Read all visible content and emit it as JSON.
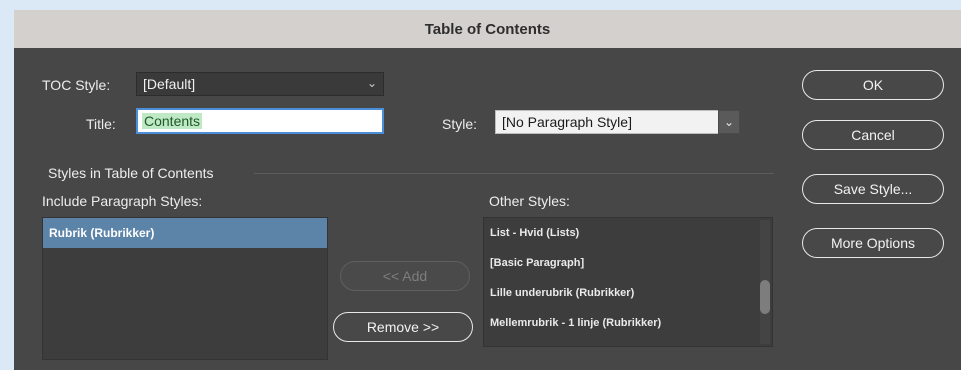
{
  "dialog": {
    "title": "Table of Contents"
  },
  "toc_style": {
    "label": "TOC Style:",
    "value": "[Default]"
  },
  "title_field": {
    "label": "Title:",
    "value": "Contents"
  },
  "style_field": {
    "label": "Style:",
    "value": "[No Paragraph Style]"
  },
  "section_heading": "Styles in Table of Contents",
  "include_styles": {
    "label": "Include Paragraph Styles:",
    "items": [
      "Rubrik (Rubrikker)"
    ]
  },
  "other_styles": {
    "label": "Other Styles:",
    "items": [
      "List - Hvid (Lists)",
      "[Basic Paragraph]",
      "Lille underubrik (Rubrikker)",
      "Mellemrubrik - 1 linje (Rubrikker)"
    ]
  },
  "buttons": {
    "ok": "OK",
    "cancel": "Cancel",
    "save_style": "Save Style...",
    "more_options": "More Options",
    "add": "<< Add",
    "remove": "Remove >>"
  },
  "icons": {
    "dropdown": "chevron-down-icon"
  },
  "colors": {
    "dialog_bg": "#474747",
    "titlebar_bg": "#d4d0cd",
    "selection_bg": "#5c84a8",
    "focus_border": "#4a8fd8",
    "text_selection": "#bfe9c4"
  }
}
